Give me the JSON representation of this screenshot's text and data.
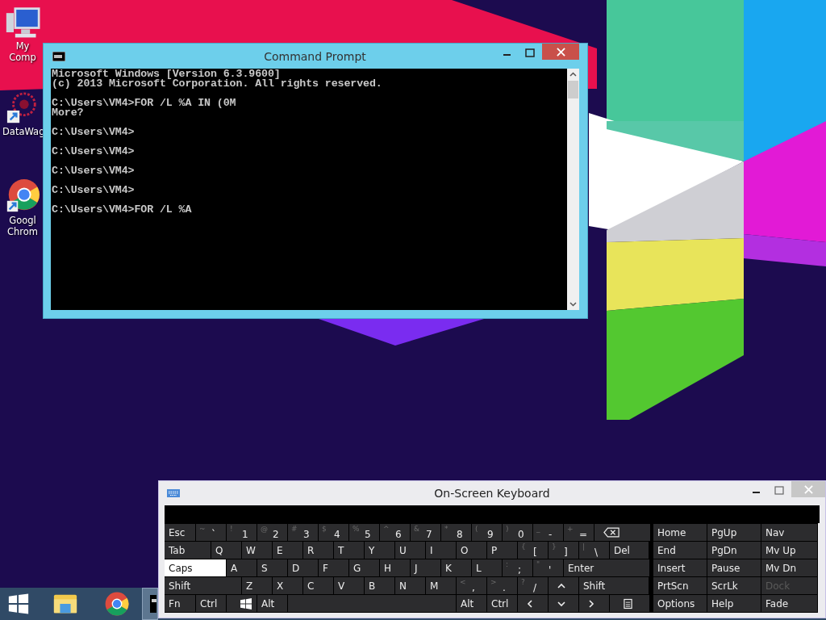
{
  "desktop_icons": [
    {
      "kind": "computer",
      "label": "My Comp"
    },
    {
      "kind": "app",
      "label": "DataWag"
    },
    {
      "kind": "chrome",
      "label": "Googl Chrom"
    }
  ],
  "command_prompt": {
    "title": "Command Prompt",
    "blocks": [
      [
        "Microsoft Windows [Version 6.3.9600]",
        "(c) 2013 Microsoft Corporation. All rights reserved."
      ],
      [
        "C:\\Users\\VM4>FOR /L %A IN (0M",
        "More?"
      ],
      [
        "C:\\Users\\VM4>"
      ],
      [
        "C:\\Users\\VM4>"
      ],
      [
        "C:\\Users\\VM4>"
      ],
      [
        "C:\\Users\\VM4>"
      ],
      [
        "C:\\Users\\VM4>FOR /L %A"
      ]
    ]
  },
  "keyboard": {
    "title": "On-Screen Keyboard",
    "main_rows": [
      [
        {
          "kind": "key",
          "label": "Esc",
          "on": false
        },
        {
          "kind": "key",
          "shift": "~",
          "label": "`",
          "on": false
        },
        {
          "kind": "key",
          "shift": "!",
          "label": "1",
          "on": false
        },
        {
          "kind": "key",
          "shift": "@",
          "label": "2",
          "on": false
        },
        {
          "kind": "key",
          "shift": "#",
          "label": "3",
          "on": false
        },
        {
          "kind": "key",
          "shift": "$",
          "label": "4",
          "on": false
        },
        {
          "kind": "key",
          "shift": "%",
          "label": "5",
          "on": false
        },
        {
          "kind": "key",
          "shift": "^",
          "label": "6",
          "on": false
        },
        {
          "kind": "key",
          "shift": "&",
          "label": "7",
          "on": false
        },
        {
          "kind": "key",
          "shift": "*",
          "label": "8",
          "on": false
        },
        {
          "kind": "key",
          "shift": "(",
          "label": "9",
          "on": false
        },
        {
          "kind": "key",
          "shift": ")",
          "label": "0",
          "on": false
        },
        {
          "kind": "key",
          "shift": "_",
          "label": "-",
          "on": false
        },
        {
          "kind": "key",
          "shift": "+",
          "label": "=",
          "on": false
        },
        {
          "kind": "backspace",
          "on": false
        }
      ],
      [
        {
          "kind": "key",
          "label": "Tab",
          "on": false
        },
        {
          "kind": "key",
          "label": "Q",
          "on": false
        },
        {
          "kind": "key",
          "label": "W",
          "on": false
        },
        {
          "kind": "key",
          "label": "E",
          "on": false
        },
        {
          "kind": "key",
          "label": "R",
          "on": false
        },
        {
          "kind": "key",
          "label": "T",
          "on": false
        },
        {
          "kind": "key",
          "label": "Y",
          "on": false
        },
        {
          "kind": "key",
          "label": "U",
          "on": false
        },
        {
          "kind": "key",
          "label": "I",
          "on": false
        },
        {
          "kind": "key",
          "label": "O",
          "on": false
        },
        {
          "kind": "key",
          "label": "P",
          "on": false
        },
        {
          "kind": "key",
          "shift": "{",
          "label": "[",
          "on": false
        },
        {
          "kind": "key",
          "shift": "}",
          "label": "]",
          "on": false
        },
        {
          "kind": "key",
          "shift": "|",
          "label": "\\",
          "on": false
        },
        {
          "kind": "key",
          "label": "Del",
          "on": false
        }
      ],
      [
        {
          "kind": "key",
          "label": "Caps",
          "on": true
        },
        {
          "kind": "key",
          "label": "A",
          "on": false
        },
        {
          "kind": "key",
          "label": "S",
          "on": false
        },
        {
          "kind": "key",
          "label": "D",
          "on": false
        },
        {
          "kind": "key",
          "label": "F",
          "on": false
        },
        {
          "kind": "key",
          "label": "G",
          "on": false
        },
        {
          "kind": "key",
          "label": "H",
          "on": false
        },
        {
          "kind": "key",
          "label": "J",
          "on": false
        },
        {
          "kind": "key",
          "label": "K",
          "on": false
        },
        {
          "kind": "key",
          "label": "L",
          "on": false
        },
        {
          "kind": "key",
          "shift": ":",
          "label": ";",
          "on": false
        },
        {
          "kind": "key",
          "shift": "\"",
          "label": "'",
          "on": false
        },
        {
          "kind": "key",
          "label": "Enter",
          "on": false
        }
      ],
      [
        {
          "kind": "key",
          "label": "Shift",
          "on": false
        },
        {
          "kind": "key",
          "label": "Z",
          "on": false
        },
        {
          "kind": "key",
          "label": "X",
          "on": false
        },
        {
          "kind": "key",
          "label": "C",
          "on": false
        },
        {
          "kind": "key",
          "label": "V",
          "on": false
        },
        {
          "kind": "key",
          "label": "B",
          "on": false
        },
        {
          "kind": "key",
          "label": "N",
          "on": false
        },
        {
          "kind": "key",
          "label": "M",
          "on": false
        },
        {
          "kind": "key",
          "shift": "<",
          "label": ",",
          "on": false
        },
        {
          "kind": "key",
          "shift": ">",
          "label": ".",
          "on": false
        },
        {
          "kind": "key",
          "shift": "?",
          "label": "/",
          "on": false
        },
        {
          "kind": "up",
          "on": false
        },
        {
          "kind": "key",
          "label": "Shift",
          "on": false
        }
      ],
      [
        {
          "kind": "key",
          "label": "Fn",
          "on": false
        },
        {
          "kind": "key",
          "label": "Ctrl",
          "on": false
        },
        {
          "kind": "winkey",
          "on": false
        },
        {
          "kind": "key",
          "label": "Alt",
          "on": false
        },
        {
          "kind": "space",
          "on": false
        },
        {
          "kind": "key",
          "label": "Alt",
          "on": false
        },
        {
          "kind": "key",
          "label": "Ctrl",
          "on": false
        },
        {
          "kind": "left",
          "on": false
        },
        {
          "kind": "down",
          "on": false
        },
        {
          "kind": "right",
          "on": false
        },
        {
          "kind": "menukey",
          "on": false
        }
      ]
    ],
    "nav_rows": [
      [
        {
          "label": "Home",
          "disabled": false
        },
        {
          "label": "PgUp",
          "disabled": false
        },
        {
          "label": "Nav",
          "disabled": false
        }
      ],
      [
        {
          "label": "End",
          "disabled": false
        },
        {
          "label": "PgDn",
          "disabled": false
        },
        {
          "label": "Mv Up",
          "disabled": false
        }
      ],
      [
        {
          "label": "Insert",
          "disabled": false
        },
        {
          "label": "Pause",
          "disabled": false
        },
        {
          "label": "Mv Dn",
          "disabled": false
        }
      ],
      [
        {
          "label": "PrtScn",
          "disabled": false
        },
        {
          "label": "ScrLk",
          "disabled": false
        },
        {
          "label": "Dock",
          "disabled": true
        }
      ],
      [
        {
          "label": "Options",
          "disabled": false
        },
        {
          "label": "Help",
          "disabled": false
        },
        {
          "label": "Fade",
          "disabled": false
        }
      ]
    ]
  },
  "taskbar": [
    {
      "kind": "start",
      "selected": false
    },
    {
      "kind": "explorer",
      "selected": false
    },
    {
      "kind": "chrome",
      "selected": false
    },
    {
      "kind": "cmd",
      "selected": true
    }
  ]
}
